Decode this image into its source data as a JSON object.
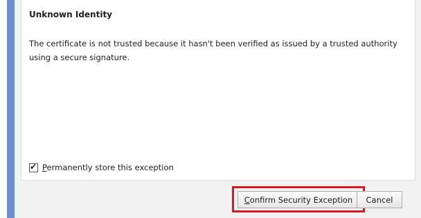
{
  "panel": {
    "title": "Unknown Identity",
    "description": "The certificate is not trusted because it hasn't been verified as issued by a trusted authority using a secure signature."
  },
  "checkbox": {
    "label_prefix": "",
    "label_underlined": "P",
    "label_rest": "ermanently store this exception",
    "checked": true,
    "check_glyph": "✔"
  },
  "buttons": {
    "confirm_underlined": "C",
    "confirm_rest": "onfirm Security Exception",
    "cancel": "Cancel"
  },
  "colors": {
    "accent_border": "#6b8fd3",
    "highlight": "#d8191f",
    "dialog_background": "#f2f2f2"
  }
}
